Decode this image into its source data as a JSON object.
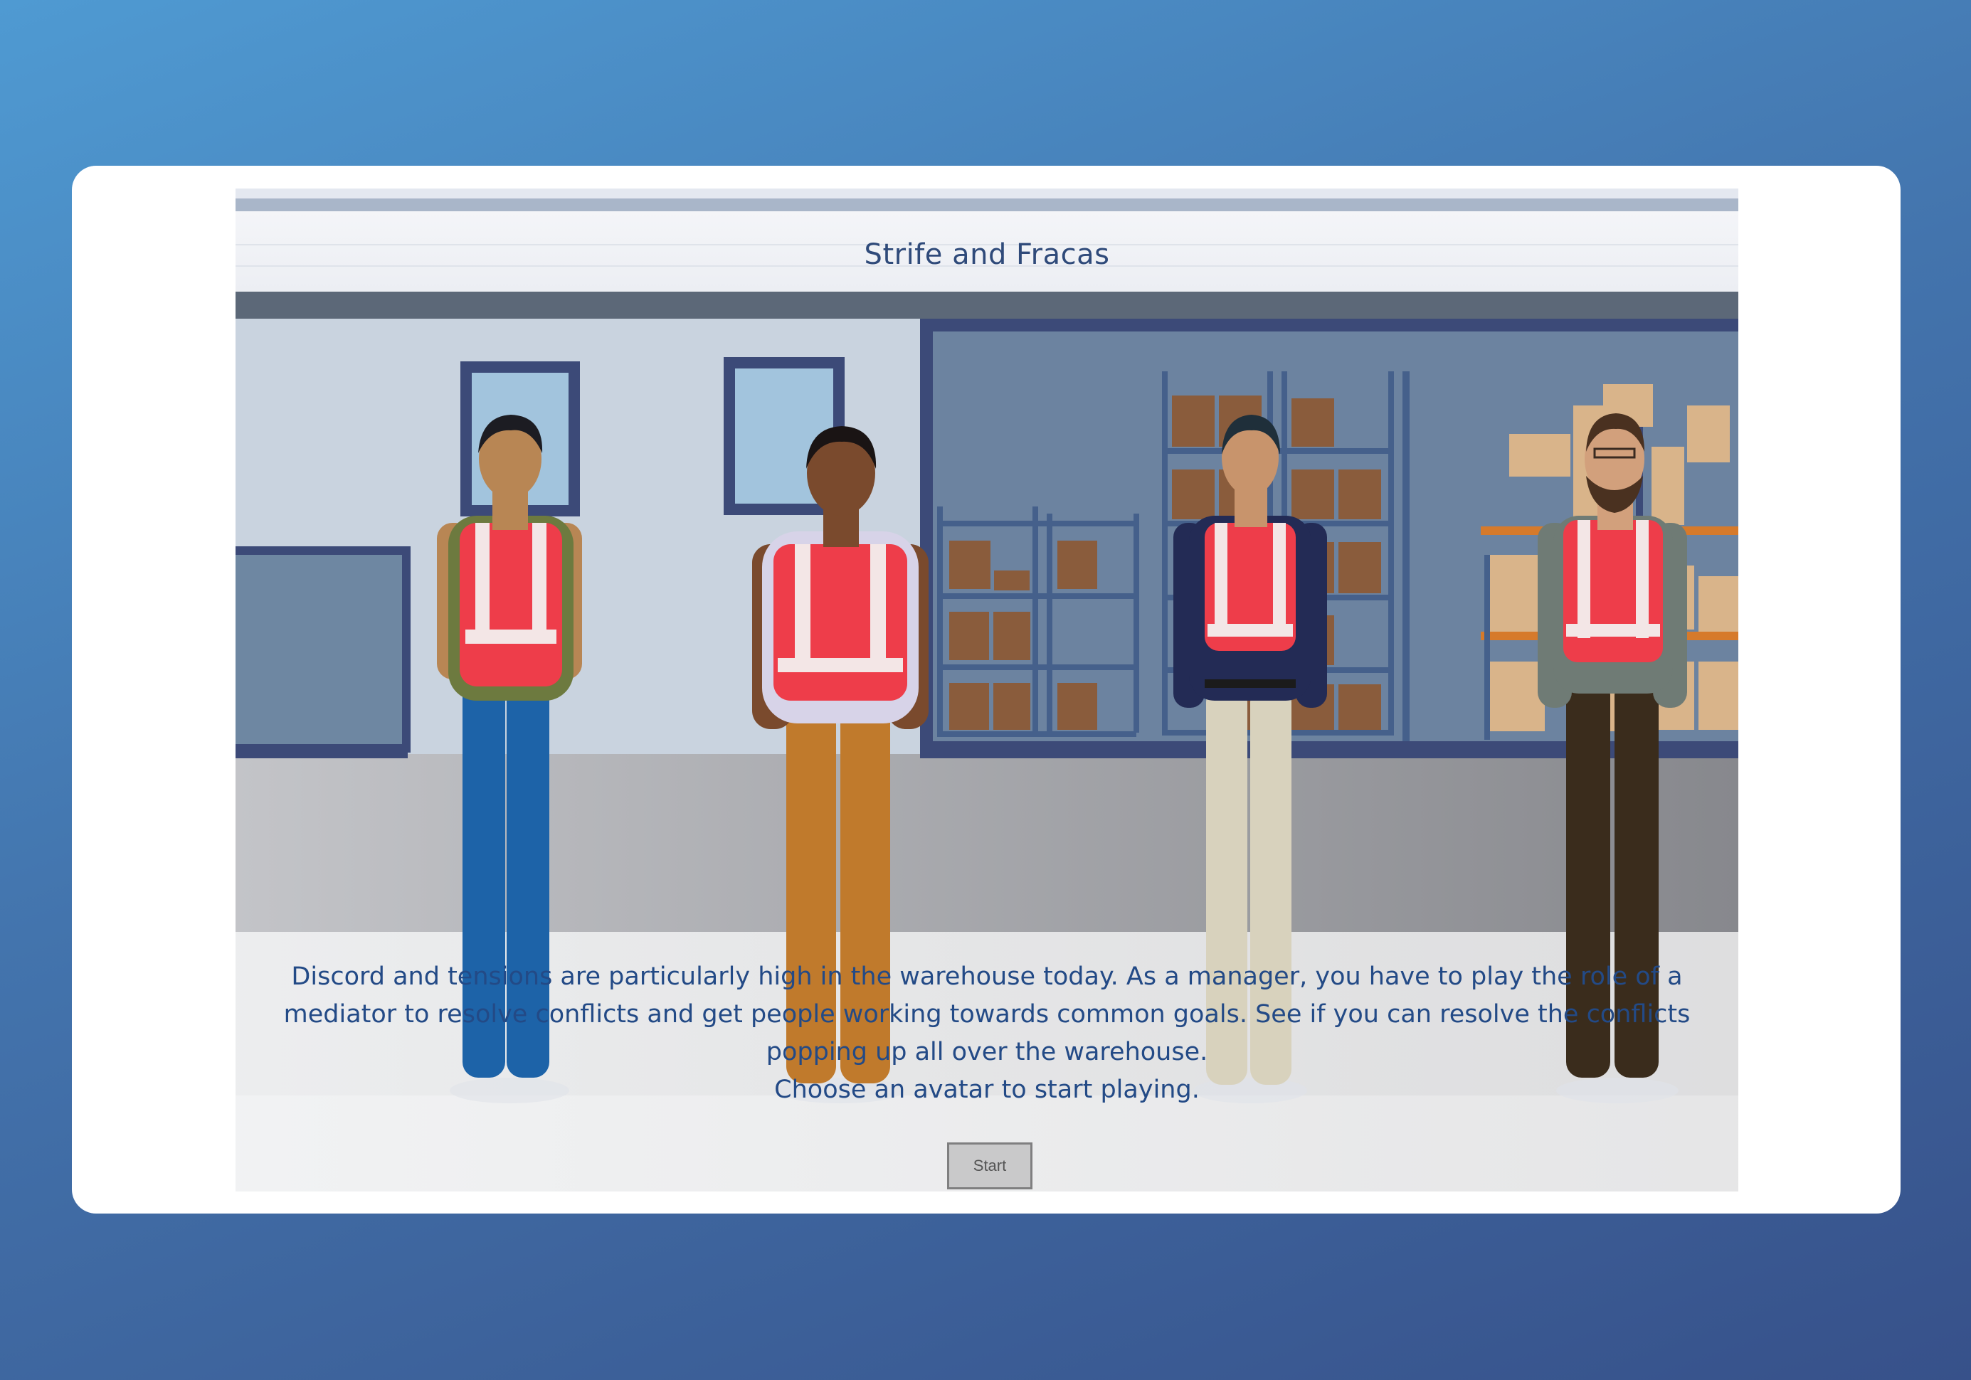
{
  "game": {
    "title": "Strife and Fracas",
    "description_lines": [
      "Discord and tensions are particularly high in the warehouse today. As a manager, you have to play the role of a",
      "mediator to resolve conflicts and get people working towards common goals. See if you can resolve the conflicts",
      "popping up all over the warehouse."
    ],
    "prompt": "Choose an avatar to start playing.",
    "start_label": "Start",
    "avatars": [
      {
        "id": "avatar-1",
        "shirt": "#6d7a3f",
        "pants": "#1d63a8",
        "skin": "#b88654",
        "hair": "#1c1c22"
      },
      {
        "id": "avatar-2",
        "shirt": "#d7d3e8",
        "pants": "#c07a2c",
        "skin": "#7a4a2d",
        "hair": "#1a1414"
      },
      {
        "id": "avatar-3",
        "shirt": "#232b55",
        "pants": "#d8d2bd",
        "skin": "#c8946c",
        "hair": "#1f2f3a"
      },
      {
        "id": "avatar-4",
        "shirt": "#6f7b75",
        "pants": "#3a2c1c",
        "skin": "#d2a07c",
        "hair": "#4a3120"
      }
    ]
  },
  "colors": {
    "vest": "#ee3d4a",
    "title_text": "#2f4a7a",
    "description_text": "#234a86",
    "background_top": "#4f9ad2",
    "background_bottom": "#37518a"
  }
}
